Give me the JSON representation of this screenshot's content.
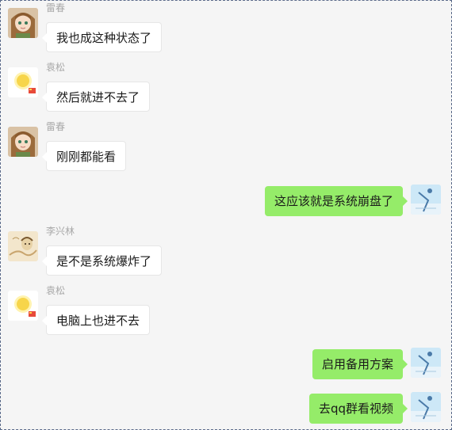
{
  "messages": [
    {
      "sender": "雷春",
      "text": "我也成这种状态了",
      "avatar": "anime-girl-avatar-icon"
    },
    {
      "sender": "袁松",
      "text": "然后就进不去了",
      "avatar": "sun-flag-avatar-icon"
    },
    {
      "sender": "雷春",
      "text": "刚刚都能看",
      "avatar": "anime-girl-avatar-icon"
    },
    {
      "sender": "",
      "text": "这应该就是系统崩盘了",
      "avatar": "sky-figure-avatar-icon"
    },
    {
      "sender": "李兴林",
      "text": "是不是系统爆炸了",
      "avatar": "sketch-avatar-icon"
    },
    {
      "sender": "袁松",
      "text": "电脑上也进不去",
      "avatar": "sun-flag-avatar-icon"
    },
    {
      "sender": "",
      "text": "启用备用方案",
      "avatar": "sky-figure-avatar-icon"
    },
    {
      "sender": "",
      "text": "去qq群看视频",
      "avatar": "sky-figure-avatar-icon"
    }
  ],
  "colors": {
    "background": "#f5f5f5",
    "incoming_bubble": "#ffffff",
    "outgoing_bubble": "#95ec69",
    "sender_name": "#a8a8a8",
    "border": "#5a6a8a"
  }
}
